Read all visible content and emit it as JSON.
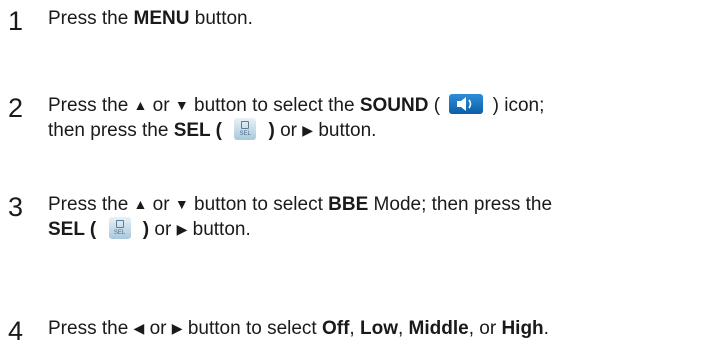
{
  "steps": [
    {
      "number": "1",
      "parts": {
        "a": "Press the ",
        "b": "MENU",
        "c": " button."
      }
    },
    {
      "number": "2",
      "line1": {
        "a": "Press the ",
        "up": "▲",
        "or": " or ",
        "down": "▼",
        "b": " button to select the ",
        "c": "SOUND",
        "d": " ( ",
        "e": " ) icon;"
      },
      "line2": {
        "a": "then press the ",
        "b": "SEL ( ",
        "c": " )",
        "d": " or ",
        "right": "▶",
        "e": " button."
      }
    },
    {
      "number": "3",
      "line1": {
        "a": "Press the ",
        "up": "▲",
        "or": " or ",
        "down": "▼",
        "b": " button to select ",
        "c": "BBE",
        "d": " Mode; then press the"
      },
      "line2": {
        "b": "SEL ( ",
        "c": " )",
        "d": " or ",
        "right": "▶",
        "e": " button."
      }
    },
    {
      "number": "4",
      "line1": {
        "a": "Press the ",
        "left": "◀",
        "or": " or ",
        "right": "▶",
        "b": " button to select ",
        "off": "Off",
        "s1": ", ",
        "low": "Low",
        "s2": ", ",
        "mid": "Middle",
        "s3": ", or ",
        "high": "High",
        "end": "."
      }
    }
  ],
  "sel_icon_label": "SEL",
  "icons": {
    "sound": "speaker-icon",
    "sel": "sel-button-icon"
  }
}
